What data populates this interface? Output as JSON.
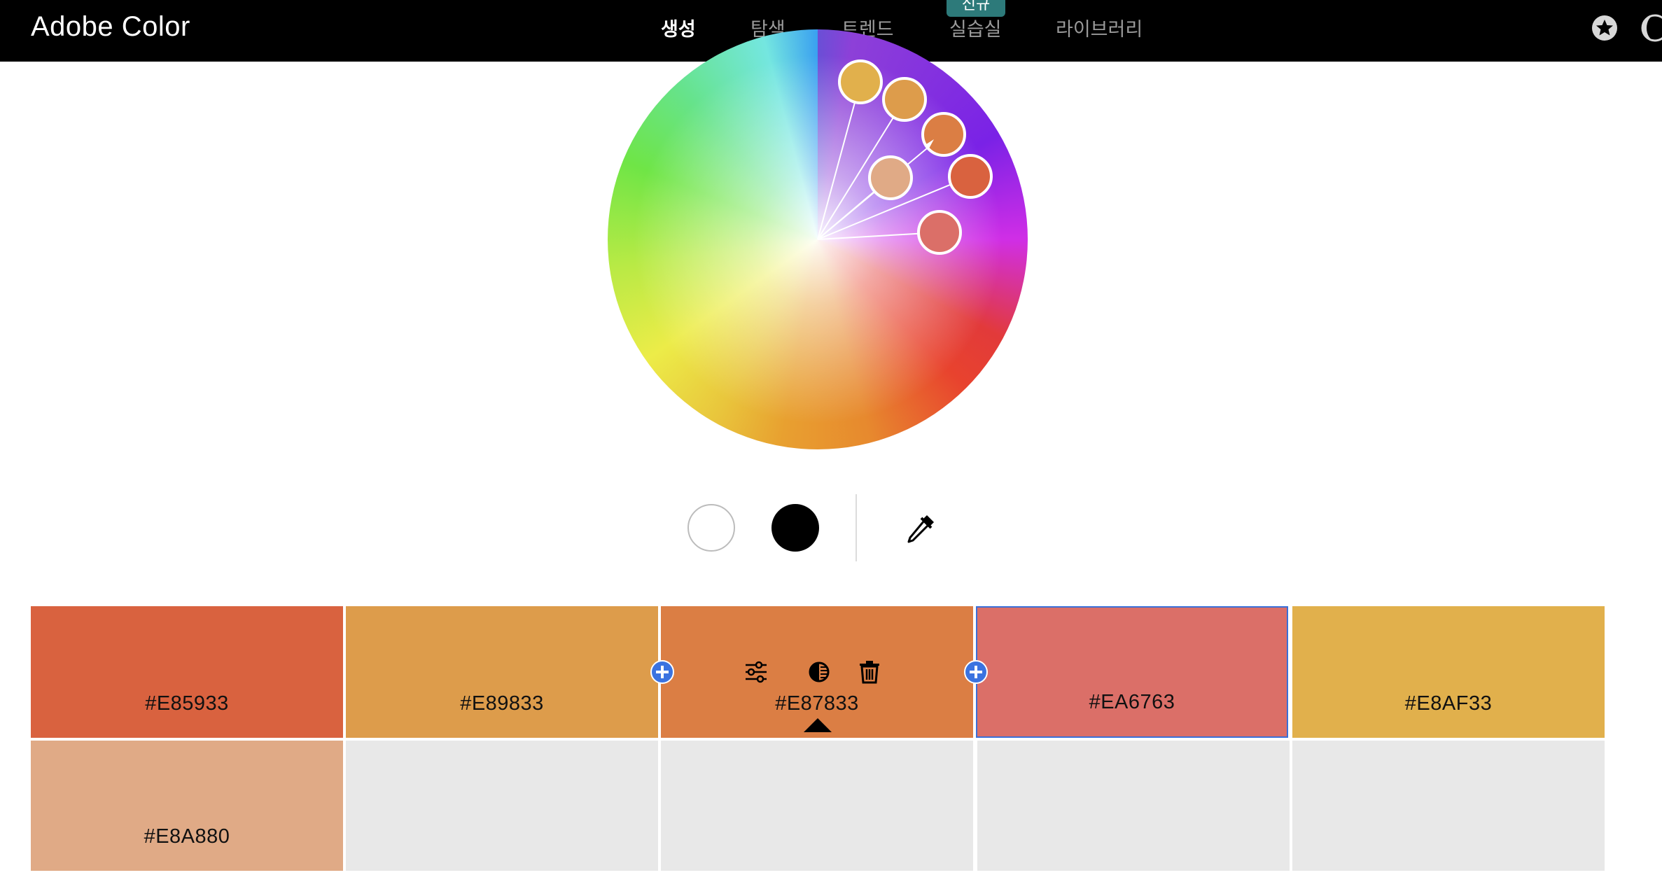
{
  "app": {
    "title": "Adobe Color"
  },
  "nav": {
    "items": [
      {
        "label": "생성",
        "active": true
      },
      {
        "label": "탐색",
        "active": false
      },
      {
        "label": "트렌드",
        "active": false
      },
      {
        "label": "실습실",
        "active": false
      },
      {
        "label": "라이브러리",
        "active": false
      }
    ],
    "new_badge": "신규"
  },
  "icons": {
    "favorite": "star-circle-icon",
    "theme": "moon-icon",
    "eyedropper": "eyedropper-icon",
    "adjust": "sliders-icon",
    "contrast": "contrast-icon",
    "delete": "trash-icon",
    "add": "plus-circle-icon"
  },
  "tools": {
    "white_label": "white",
    "black_label": "black"
  },
  "swatches": [
    {
      "hex": "#E85933",
      "color": "#D9623F"
    },
    {
      "hex": "#E89833",
      "color": "#DD9C4B"
    },
    {
      "hex": "#E87833",
      "color": "#DB7E44",
      "active": true
    },
    {
      "hex": "#EA6763",
      "color": "#DB6F68",
      "selected": true
    },
    {
      "hex": "#E8AF33",
      "color": "#E1B04C"
    },
    {
      "hex": "#E8A880",
      "color": "#E0AA86"
    }
  ]
}
